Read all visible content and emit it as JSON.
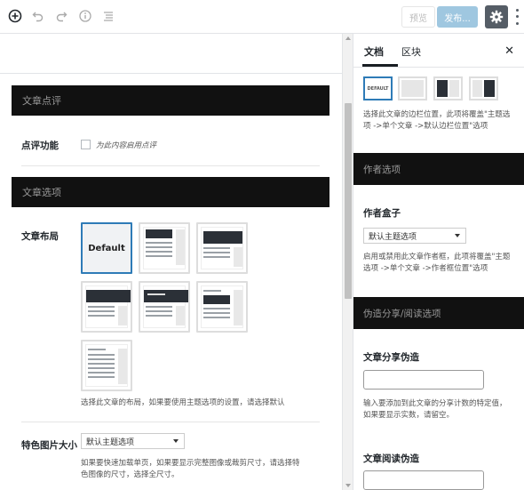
{
  "toolbar": {
    "preview_label": "预览",
    "publish_label": "发布...",
    "icons": [
      "add-block-icon",
      "undo-icon",
      "redo-icon",
      "info-icon",
      "list-view-icon",
      "gear-icon",
      "more-icon"
    ]
  },
  "main": {
    "review_section": {
      "header": "文章点评",
      "field_label": "点评功能",
      "checkbox_hint": "为此内容启用点评"
    },
    "options_section": {
      "header": "文章选项",
      "layout_label": "文章布局",
      "default_tile_label": "Default",
      "layout_hint": "选择此文章的布局，如果要使用主题选项的设置，请选择默认",
      "image_size_label": "特色图片大小",
      "image_size_value": "默认主题选项",
      "image_size_hint_1": "如果要快速加载单页，如果要显示完整图像或裁剪尺寸，请选择特",
      "image_size_hint_2": "色图像的尺寸，选择全尺寸。"
    }
  },
  "sidebar": {
    "tabs": [
      "文档",
      "区块"
    ],
    "default_pos_label": "DEFAULT",
    "sidebar_hint_1": "选择此文章的边栏位置，此项将覆盖\"主题选",
    "sidebar_hint_2": "项 ->单个文章 ->默认边栏位置\"选项",
    "author_section": {
      "header": "作者选项",
      "label": "作者盒子",
      "select_value": "默认主题选项",
      "hint_1": "启用或禁用此文章作者框，此项将覆盖\"主题",
      "hint_2": "选项 ->单个文章 ->作者框位置\"选项"
    },
    "fake_section": {
      "header": "伪造分享/阅读选项",
      "share_label": "文章分享伪造",
      "share_hint_1": "输入要添加到此文章的分享计数的特定值，",
      "share_hint_2": "如果要显示实数，请留空。",
      "read_label": "文章阅读伪造"
    }
  },
  "colors": {
    "accent": "#2e7bb7",
    "section_header_bg": "#111111",
    "publish_bg": "#9fc7e0"
  }
}
